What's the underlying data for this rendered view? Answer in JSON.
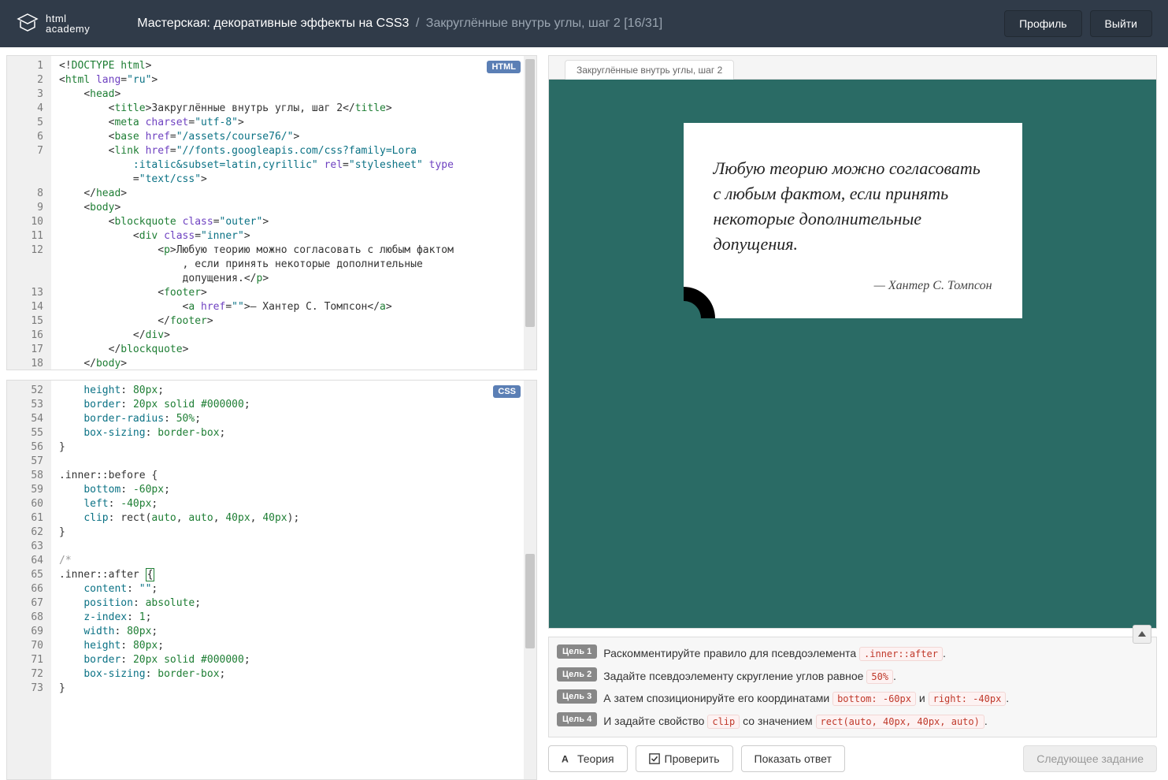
{
  "header": {
    "logo_line1": "html",
    "logo_line2": "academy",
    "breadcrumb_main": "Мастерская: декоративные эффекты на CSS3",
    "breadcrumb_sub": "Закруглённые внутрь углы, шаг 2 [16/31]",
    "profile_label": "Профиль",
    "logout_label": "Выйти"
  },
  "editors": {
    "html_badge": "HTML",
    "css_badge": "CSS",
    "html_gutter": [
      "1",
      "2",
      "3",
      "4",
      "5",
      "6",
      "7",
      "",
      "",
      "8",
      "9",
      "10",
      "11",
      "12",
      "",
      "",
      "13",
      "14",
      "15",
      "16",
      "17",
      "18"
    ],
    "html_lines": [
      {
        "indent": 0,
        "parts": [
          {
            "c": "punc",
            "t": "<!"
          },
          {
            "c": "tag",
            "t": "DOCTYPE html"
          },
          {
            "c": "punc",
            "t": ">"
          }
        ]
      },
      {
        "indent": 0,
        "parts": [
          {
            "c": "punc",
            "t": "<"
          },
          {
            "c": "tag",
            "t": "html"
          },
          {
            "c": "txt",
            "t": " "
          },
          {
            "c": "attr",
            "t": "lang"
          },
          {
            "c": "punc",
            "t": "="
          },
          {
            "c": "str",
            "t": "\"ru\""
          },
          {
            "c": "punc",
            "t": ">"
          }
        ]
      },
      {
        "indent": 1,
        "parts": [
          {
            "c": "punc",
            "t": "<"
          },
          {
            "c": "tag",
            "t": "head"
          },
          {
            "c": "punc",
            "t": ">"
          }
        ]
      },
      {
        "indent": 2,
        "parts": [
          {
            "c": "punc",
            "t": "<"
          },
          {
            "c": "tag",
            "t": "title"
          },
          {
            "c": "punc",
            "t": ">"
          },
          {
            "c": "txt",
            "t": "Закруглённые внутрь углы, шаг 2"
          },
          {
            "c": "punc",
            "t": "</"
          },
          {
            "c": "tag",
            "t": "title"
          },
          {
            "c": "punc",
            "t": ">"
          }
        ]
      },
      {
        "indent": 2,
        "parts": [
          {
            "c": "punc",
            "t": "<"
          },
          {
            "c": "tag",
            "t": "meta"
          },
          {
            "c": "txt",
            "t": " "
          },
          {
            "c": "attr",
            "t": "charset"
          },
          {
            "c": "punc",
            "t": "="
          },
          {
            "c": "str",
            "t": "\"utf-8\""
          },
          {
            "c": "punc",
            "t": ">"
          }
        ]
      },
      {
        "indent": 2,
        "parts": [
          {
            "c": "punc",
            "t": "<"
          },
          {
            "c": "tag",
            "t": "base"
          },
          {
            "c": "txt",
            "t": " "
          },
          {
            "c": "attr",
            "t": "href"
          },
          {
            "c": "punc",
            "t": "="
          },
          {
            "c": "str",
            "t": "\"/assets/course76/\""
          },
          {
            "c": "punc",
            "t": ">"
          }
        ]
      },
      {
        "indent": 2,
        "parts": [
          {
            "c": "punc",
            "t": "<"
          },
          {
            "c": "tag",
            "t": "link"
          },
          {
            "c": "txt",
            "t": " "
          },
          {
            "c": "attr",
            "t": "href"
          },
          {
            "c": "punc",
            "t": "="
          },
          {
            "c": "str",
            "t": "\"//fonts.googleapis.com/css?family=Lora"
          }
        ]
      },
      {
        "indent": 3,
        "parts": [
          {
            "c": "str",
            "t": ":italic&subset=latin,cyrillic\""
          },
          {
            "c": "txt",
            "t": " "
          },
          {
            "c": "attr",
            "t": "rel"
          },
          {
            "c": "punc",
            "t": "="
          },
          {
            "c": "str",
            "t": "\"stylesheet\""
          },
          {
            "c": "txt",
            "t": " "
          },
          {
            "c": "attr",
            "t": "type"
          }
        ]
      },
      {
        "indent": 3,
        "parts": [
          {
            "c": "punc",
            "t": "="
          },
          {
            "c": "str",
            "t": "\"text/css\""
          },
          {
            "c": "punc",
            "t": ">"
          }
        ]
      },
      {
        "indent": 1,
        "parts": [
          {
            "c": "punc",
            "t": "</"
          },
          {
            "c": "tag",
            "t": "head"
          },
          {
            "c": "punc",
            "t": ">"
          }
        ]
      },
      {
        "indent": 1,
        "parts": [
          {
            "c": "punc",
            "t": "<"
          },
          {
            "c": "tag",
            "t": "body"
          },
          {
            "c": "punc",
            "t": ">"
          }
        ]
      },
      {
        "indent": 2,
        "parts": [
          {
            "c": "punc",
            "t": "<"
          },
          {
            "c": "tag",
            "t": "blockquote"
          },
          {
            "c": "txt",
            "t": " "
          },
          {
            "c": "attr",
            "t": "class"
          },
          {
            "c": "punc",
            "t": "="
          },
          {
            "c": "str",
            "t": "\"outer\""
          },
          {
            "c": "punc",
            "t": ">"
          }
        ]
      },
      {
        "indent": 3,
        "parts": [
          {
            "c": "punc",
            "t": "<"
          },
          {
            "c": "tag",
            "t": "div"
          },
          {
            "c": "txt",
            "t": " "
          },
          {
            "c": "attr",
            "t": "class"
          },
          {
            "c": "punc",
            "t": "="
          },
          {
            "c": "str",
            "t": "\"inner\""
          },
          {
            "c": "punc",
            "t": ">"
          }
        ]
      },
      {
        "indent": 4,
        "parts": [
          {
            "c": "punc",
            "t": "<"
          },
          {
            "c": "tag",
            "t": "p"
          },
          {
            "c": "punc",
            "t": ">"
          },
          {
            "c": "txt",
            "t": "Любую теорию можно согласовать с любым фактом"
          }
        ]
      },
      {
        "indent": 5,
        "parts": [
          {
            "c": "txt",
            "t": ", если принять некоторые дополнительные "
          }
        ]
      },
      {
        "indent": 5,
        "parts": [
          {
            "c": "txt",
            "t": "допущения."
          },
          {
            "c": "punc",
            "t": "</"
          },
          {
            "c": "tag",
            "t": "p"
          },
          {
            "c": "punc",
            "t": ">"
          }
        ]
      },
      {
        "indent": 4,
        "parts": [
          {
            "c": "punc",
            "t": "<"
          },
          {
            "c": "tag",
            "t": "footer"
          },
          {
            "c": "punc",
            "t": ">"
          }
        ]
      },
      {
        "indent": 5,
        "parts": [
          {
            "c": "punc",
            "t": "<"
          },
          {
            "c": "tag",
            "t": "a"
          },
          {
            "c": "txt",
            "t": " "
          },
          {
            "c": "attr",
            "t": "href"
          },
          {
            "c": "punc",
            "t": "="
          },
          {
            "c": "str",
            "t": "\"\""
          },
          {
            "c": "punc",
            "t": ">"
          },
          {
            "c": "txt",
            "t": "— Хантер С. Томпсон"
          },
          {
            "c": "punc",
            "t": "</"
          },
          {
            "c": "tag",
            "t": "a"
          },
          {
            "c": "punc",
            "t": ">"
          }
        ]
      },
      {
        "indent": 4,
        "parts": [
          {
            "c": "punc",
            "t": "</"
          },
          {
            "c": "tag",
            "t": "footer"
          },
          {
            "c": "punc",
            "t": ">"
          }
        ]
      },
      {
        "indent": 3,
        "parts": [
          {
            "c": "punc",
            "t": "</"
          },
          {
            "c": "tag",
            "t": "div"
          },
          {
            "c": "punc",
            "t": ">"
          }
        ]
      },
      {
        "indent": 2,
        "parts": [
          {
            "c": "punc",
            "t": "</"
          },
          {
            "c": "tag",
            "t": "blockquote"
          },
          {
            "c": "punc",
            "t": ">"
          }
        ]
      },
      {
        "indent": 1,
        "parts": [
          {
            "c": "punc",
            "t": "</"
          },
          {
            "c": "tag",
            "t": "body"
          },
          {
            "c": "punc",
            "t": ">"
          }
        ]
      }
    ],
    "css_gutter": [
      "52",
      "53",
      "54",
      "55",
      "56",
      "57",
      "58",
      "59",
      "60",
      "61",
      "62",
      "63",
      "64",
      "65",
      "66",
      "67",
      "68",
      "69",
      "70",
      "71",
      "72",
      "73"
    ],
    "css_lines": [
      {
        "indent": 1,
        "parts": [
          {
            "c": "prop",
            "t": "height"
          },
          {
            "c": "punc",
            "t": ": "
          },
          {
            "c": "num",
            "t": "80px"
          },
          {
            "c": "punc",
            "t": ";"
          }
        ]
      },
      {
        "indent": 1,
        "parts": [
          {
            "c": "prop",
            "t": "border"
          },
          {
            "c": "punc",
            "t": ": "
          },
          {
            "c": "num",
            "t": "20px"
          },
          {
            "c": "txt",
            "t": " "
          },
          {
            "c": "val",
            "t": "solid"
          },
          {
            "c": "txt",
            "t": " "
          },
          {
            "c": "num",
            "t": "#000000"
          },
          {
            "c": "punc",
            "t": ";"
          }
        ]
      },
      {
        "indent": 1,
        "parts": [
          {
            "c": "prop",
            "t": "border-radius"
          },
          {
            "c": "punc",
            "t": ": "
          },
          {
            "c": "num",
            "t": "50%"
          },
          {
            "c": "punc",
            "t": ";"
          }
        ]
      },
      {
        "indent": 1,
        "parts": [
          {
            "c": "prop",
            "t": "box-sizing"
          },
          {
            "c": "punc",
            "t": ": "
          },
          {
            "c": "val",
            "t": "border-box"
          },
          {
            "c": "punc",
            "t": ";"
          }
        ]
      },
      {
        "indent": 0,
        "parts": [
          {
            "c": "punc",
            "t": "}"
          }
        ]
      },
      {
        "indent": 0,
        "parts": []
      },
      {
        "indent": 0,
        "parts": [
          {
            "c": "sel",
            "t": ".inner::before {"
          }
        ]
      },
      {
        "indent": 1,
        "parts": [
          {
            "c": "prop",
            "t": "bottom"
          },
          {
            "c": "punc",
            "t": ": "
          },
          {
            "c": "num",
            "t": "-60px"
          },
          {
            "c": "punc",
            "t": ";"
          }
        ]
      },
      {
        "indent": 1,
        "parts": [
          {
            "c": "prop",
            "t": "left"
          },
          {
            "c": "punc",
            "t": ": "
          },
          {
            "c": "num",
            "t": "-40px"
          },
          {
            "c": "punc",
            "t": ";"
          }
        ]
      },
      {
        "indent": 1,
        "parts": [
          {
            "c": "prop",
            "t": "clip"
          },
          {
            "c": "punc",
            "t": ": "
          },
          {
            "c": "txt",
            "t": "rect("
          },
          {
            "c": "val",
            "t": "auto"
          },
          {
            "c": "punc",
            "t": ", "
          },
          {
            "c": "val",
            "t": "auto"
          },
          {
            "c": "punc",
            "t": ", "
          },
          {
            "c": "num",
            "t": "40px"
          },
          {
            "c": "punc",
            "t": ", "
          },
          {
            "c": "num",
            "t": "40px"
          },
          {
            "c": "punc",
            "t": ");"
          }
        ]
      },
      {
        "indent": 0,
        "parts": [
          {
            "c": "punc",
            "t": "}"
          }
        ]
      },
      {
        "indent": 0,
        "parts": []
      },
      {
        "indent": 0,
        "parts": [
          {
            "c": "com",
            "t": "/*"
          }
        ]
      },
      {
        "indent": 0,
        "parts": [
          {
            "c": "sel",
            "t": ".inner::after "
          },
          {
            "c": "cursor",
            "t": "{"
          }
        ]
      },
      {
        "indent": 1,
        "parts": [
          {
            "c": "prop",
            "t": "content"
          },
          {
            "c": "punc",
            "t": ": "
          },
          {
            "c": "str",
            "t": "\"\""
          },
          {
            "c": "punc",
            "t": ";"
          }
        ]
      },
      {
        "indent": 1,
        "parts": [
          {
            "c": "prop",
            "t": "position"
          },
          {
            "c": "punc",
            "t": ": "
          },
          {
            "c": "val",
            "t": "absolute"
          },
          {
            "c": "punc",
            "t": ";"
          }
        ]
      },
      {
        "indent": 1,
        "parts": [
          {
            "c": "prop",
            "t": "z-index"
          },
          {
            "c": "punc",
            "t": ": "
          },
          {
            "c": "num",
            "t": "1"
          },
          {
            "c": "punc",
            "t": ";"
          }
        ]
      },
      {
        "indent": 1,
        "parts": [
          {
            "c": "prop",
            "t": "width"
          },
          {
            "c": "punc",
            "t": ": "
          },
          {
            "c": "num",
            "t": "80px"
          },
          {
            "c": "punc",
            "t": ";"
          }
        ]
      },
      {
        "indent": 1,
        "parts": [
          {
            "c": "prop",
            "t": "height"
          },
          {
            "c": "punc",
            "t": ": "
          },
          {
            "c": "num",
            "t": "80px"
          },
          {
            "c": "punc",
            "t": ";"
          }
        ]
      },
      {
        "indent": 1,
        "parts": [
          {
            "c": "prop",
            "t": "border"
          },
          {
            "c": "punc",
            "t": ": "
          },
          {
            "c": "num",
            "t": "20px"
          },
          {
            "c": "txt",
            "t": " "
          },
          {
            "c": "val",
            "t": "solid"
          },
          {
            "c": "txt",
            "t": " "
          },
          {
            "c": "num",
            "t": "#000000"
          },
          {
            "c": "punc",
            "t": ";"
          }
        ]
      },
      {
        "indent": 1,
        "parts": [
          {
            "c": "prop",
            "t": "box-sizing"
          },
          {
            "c": "punc",
            "t": ": "
          },
          {
            "c": "val",
            "t": "border-box"
          },
          {
            "c": "punc",
            "t": ";"
          }
        ]
      },
      {
        "indent": 0,
        "parts": [
          {
            "c": "punc",
            "t": "}"
          }
        ]
      }
    ]
  },
  "preview": {
    "tab_label": "Закруглённые внутрь углы, шаг 2",
    "quote": "Любую теорию можно согласовать с любым фактом, если принять некоторые дополнительные допущения.",
    "author": "— Хантер С. Томпсон"
  },
  "goals": [
    {
      "badge": "Цель 1",
      "text": "Раскомментируйте правило для псевдоэлемента ",
      "code": ".inner::after",
      "suffix": "."
    },
    {
      "badge": "Цель 2",
      "text": "Задайте псевдоэлементу скругление углов равное ",
      "code": "50%",
      "suffix": "."
    },
    {
      "badge": "Цель 3",
      "text": "А затем спозиционируйте его координатами ",
      "code": "bottom: -60px",
      "mid": " и ",
      "code2": "right: -40px",
      "suffix": "."
    },
    {
      "badge": "Цель 4",
      "text": "И задайте свойство ",
      "code": "clip",
      "mid": " со значением ",
      "code2": "rect(auto, 40px, 40px, auto)",
      "suffix": "."
    }
  ],
  "actions": {
    "theory": "Теория",
    "check": "Проверить",
    "show_answer": "Показать ответ",
    "next": "Следующее задание"
  }
}
